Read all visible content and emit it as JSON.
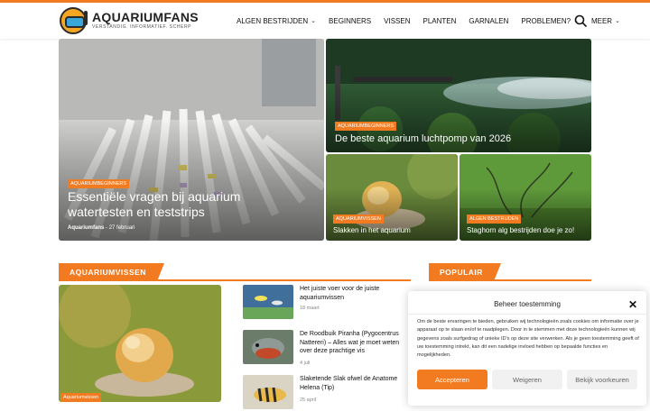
{
  "brand": {
    "name_main": "AQUARIUMFANS",
    "tagline": "VERSTANDIG. INFORMATIEF. SCHERP"
  },
  "nav": {
    "items": [
      {
        "label": "ALGEN BESTRIJDEN",
        "dropdown": true
      },
      {
        "label": "BEGINNERS",
        "dropdown": false
      },
      {
        "label": "VISSEN",
        "dropdown": false
      },
      {
        "label": "PLANTEN",
        "dropdown": false
      },
      {
        "label": "GARNALEN",
        "dropdown": false
      },
      {
        "label": "PROBLEMEN?",
        "dropdown": true
      },
      {
        "label": "MEER",
        "dropdown": true
      }
    ]
  },
  "featured": {
    "main": {
      "category": "AQUARIUMBEGINNERS",
      "title": "Essentiële vragen bij aquarium watertesten en teststrips",
      "author": "Aquariumfans",
      "date": "27 februari"
    },
    "top_right": {
      "category": "AQUARIUMBEGINNERS",
      "title": "De beste aquarium luchtpomp van 2026"
    },
    "bottom_left": {
      "category": "AQUARIUMVISSEN",
      "title": "Slakken in het aquarium"
    },
    "bottom_right": {
      "category": "ALGEN BESTRIJDEN",
      "title": "Staghorn alg bestrijden doe je zo!"
    }
  },
  "sections": {
    "aquariumvissen": {
      "heading": "AQUARIUMVISSEN",
      "big_category": "Aquariumvissen",
      "items": [
        {
          "title": "Het juiste voer voor de juiste aquariumvissen",
          "date": "18 maart"
        },
        {
          "title": "De Roodbuik Piranha (Pygocentrus Nattereri) – Alles wat je moet weten over deze prachtige vis",
          "date": "4 juli"
        },
        {
          "title": "Slaketende Slak ofwel de Anatome Helena (Tip)",
          "date": "25 april"
        }
      ]
    },
    "popular": {
      "heading": "POPULAIR"
    }
  },
  "consent": {
    "title": "Beheer toestemming",
    "body": "Om de beste ervaringen te bieden, gebruiken wij technologieën zoals cookies om informatie over je apparaat op te slaan en/of te raadplegen. Door in te stemmen met deze technologieën kunnen wij gegevens zoals surfgedrag of unieke ID's op deze site verwerken. Als je geen toestemming geeft of uw toestemming intrekt, kan dit een nadelige invloed hebben op bepaalde functies en mogelijkheden.",
    "accept": "Accepteren",
    "deny": "Weigeren",
    "prefs": "Bekijk voorkeuren"
  },
  "colors": {
    "accent": "#f27b21"
  }
}
